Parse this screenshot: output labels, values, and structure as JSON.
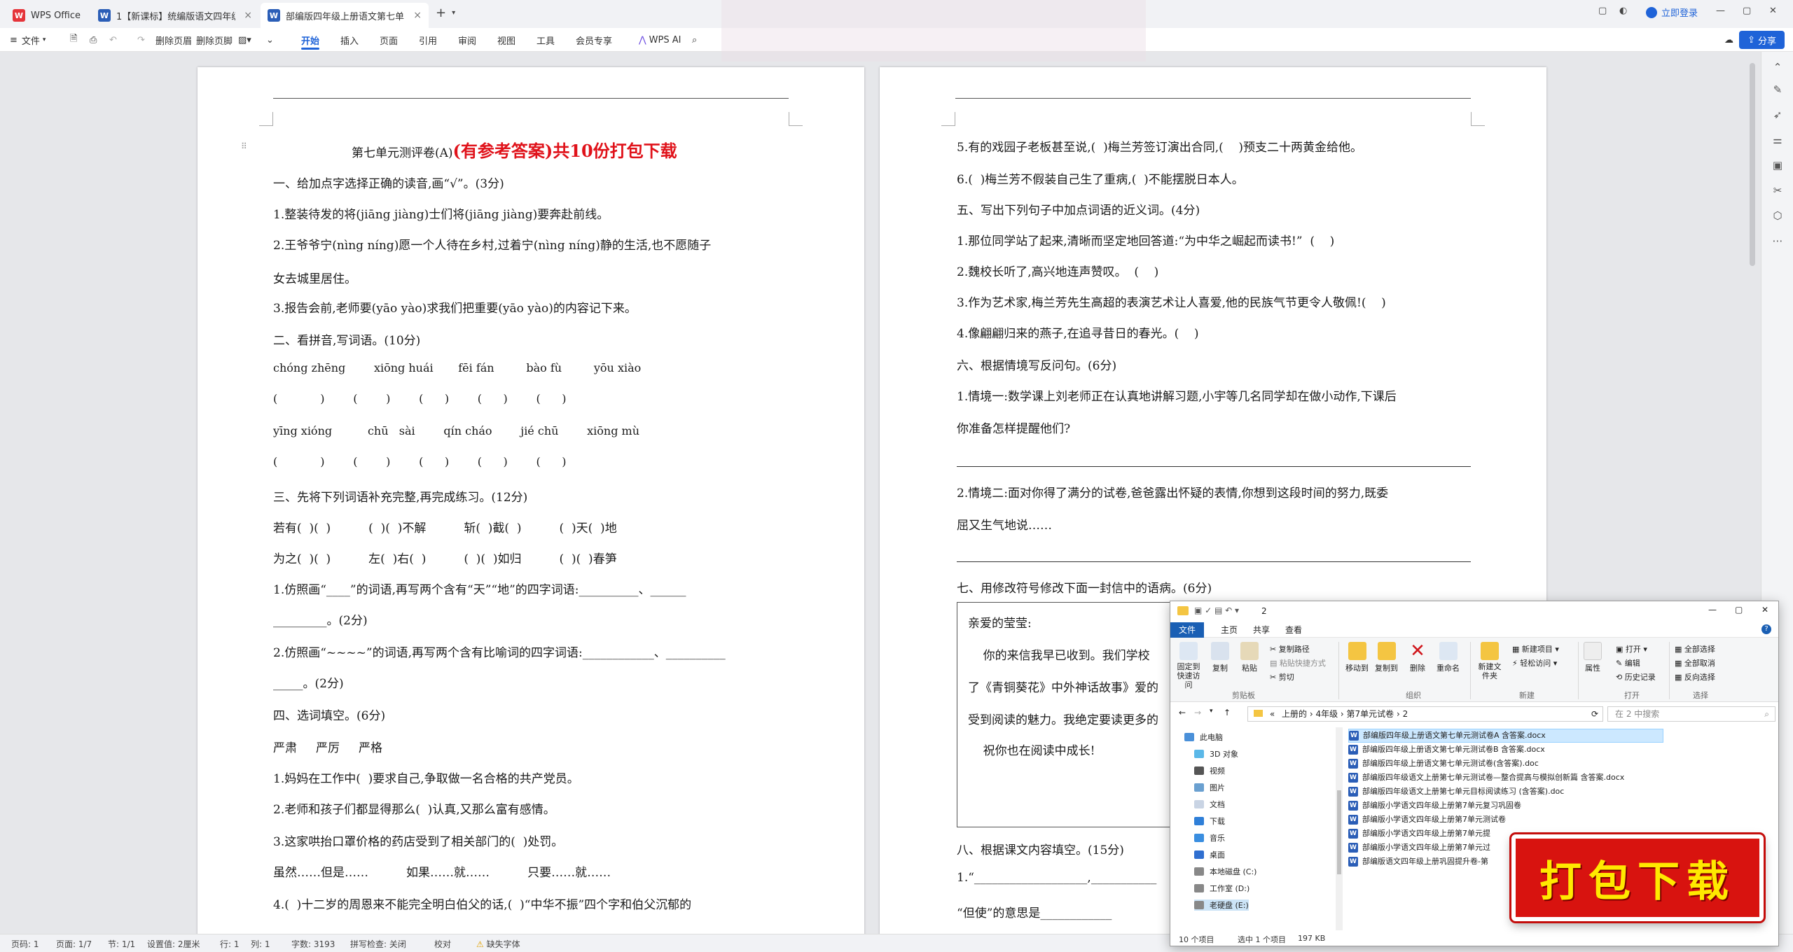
{
  "tabs": [
    {
      "label": "WPS Office",
      "icon": "wps-logo-icon"
    },
    {
      "label": "1【新课标】统编版语文四年级上册第",
      "icon": "word-doc-icon"
    },
    {
      "label": "部编版四年级上册语文第七单",
      "icon": "word-doc-icon"
    }
  ],
  "titlebar": {
    "login": "立即登录",
    "new_tab": "+"
  },
  "ribbon": {
    "file": "文件",
    "delete_header": "删除页眉",
    "delete_footer": "删除页脚",
    "tabs": [
      "开始",
      "插入",
      "页面",
      "引用",
      "审阅",
      "视图",
      "工具",
      "会员专享"
    ],
    "wps_ai": "WPS AI",
    "share": "分享"
  },
  "left_page": {
    "title_plain": "第七单元测评卷(A)",
    "title_red": "(有参考答案)共10份打包下载",
    "lines": [
      "一、给加点字选择正确的读音,画“√”。(3分)",
      "1.整装待发的将(jiāng jiàng)士们将(jiāng jiàng)要奔赴前线。",
      "2.王爷爷宁(nìng níng)愿一个人待在乡村,过着宁(nìng níng)静的生活,也不愿随子",
      "女去城里居住。",
      "3.报告会前,老师要(yāo yào)求我们把重要(yāo yào)的内容记下来。",
      "二、看拼音,写词语。(10分)",
      "chóng zhēng        xiōng huái       fēi fán         bào fù         yōu xiào",
      "(            )        (        )        (      )        (      )        (      )",
      "yīng xióng          chū   sài        qín cháo        jié chū        xiōng mù",
      "(            )        (        )        (      )        (      )        (      )",
      "三、先将下列词语补充完整,再完成练习。(12分)",
      "若有(  )(  )          (  )(  )不解          斩(  )截(  )          (  )天(  )地",
      "为之(  )(  )          左(  )右(  )          (  )(  )如归          (  )(  )春笋",
      "1.仿照画“____”的词语,再写两个含有“天”“地”的四字词语:__________、______",
      "_________。(2分)",
      "2.仿照画“~~~~”的词语,再写两个含有比喻词的四字词语:____________、__________",
      "_____。(2分)",
      "四、选词填空。(6分)",
      "严肃     严厉     严格",
      "1.妈妈在工作中(  )要求自己,争取做一名合格的共产党员。",
      "2.老师和孩子们都显得那么(  )认真,又那么富有感情。",
      "3.这家哄抬口罩价格的药店受到了相关部门的(  )处罚。",
      "虽然……但是……          如果……就……          只要……就……",
      "4.(  )十二岁的周恩来不能完全明白伯父的话,(  )“中华不振”四个字和伯父沉郁的"
    ]
  },
  "right_page": {
    "lines": [
      "5.有的戏园子老板甚至说,(  )梅兰芳签订演出合同,(    )预支二十两黄金给他。",
      "6.(  )梅兰芳不假装自己生了重病,(  )不能摆脱日本人。",
      "五、写出下列句子中加点词语的近义词。(4分)",
      "1.那位同学站了起来,清晰而坚定地回答道:“为中华之崛起而读书!”  (    )",
      "2.魏校长听了,高兴地连声赞叹。  (    )",
      "3.作为艺术家,梅兰芳先生高超的表演艺术让人喜爱,他的民族气节更令人敬佩!(    )",
      "4.像翩翩归来的燕子,在追寻昔日的春光。(    )",
      "六、根据情境写反问句。(6分)",
      "1.情境一:数学课上刘老师正在认真地讲解习题,小宇等几名同学却在做小动作,下课后",
      "你准备怎样提醒他们?",
      "2.情境二:面对你得了满分的试卷,爸爸露出怀疑的表情,你想到这段时间的努力,既委",
      "屈又生气地说……",
      "七、用修改符号修改下面一封信中的语病。(6分)",
      "亲爱的莹莹:",
      "    你的来信我早已收到。我们学校",
      "了《青铜葵花》中外神话故事》爱的",
      "受到阅读的魅力。我绝定要读更多的",
      "    祝你也在阅读中成长!",
      "八、根据课文内容填空。(15分)",
      "1.“___________________,___________",
      "“但使”的意思是____________"
    ]
  },
  "statusbar": {
    "items": [
      "页码: 1",
      "页面: 1/7",
      "节: 1/1",
      "设置值: 2厘米",
      "行: 1",
      "列: 1",
      "字数: 3193",
      "拼写检查: 关闭",
      "校对",
      "缺失字体"
    ]
  },
  "explorer": {
    "title": "2",
    "menus": [
      "文件",
      "主页",
      "共享",
      "查看"
    ],
    "ribbon": {
      "pin": "固定到快速访问",
      "copy": "复制",
      "paste": "粘贴",
      "copy_path": "复制路径",
      "paste_shortcut": "粘贴快捷方式",
      "cut": "剪切",
      "move_to": "移动到",
      "copy_to": "复制到",
      "delete": "删除",
      "rename": "重命名",
      "new_folder": "新建文件夹",
      "new_item": "新建项目",
      "easy_access": "轻松访问",
      "properties": "属性",
      "open": "打开",
      "edit": "编辑",
      "history": "历史记录",
      "select_all": "全部选择",
      "select_none": "全部取消",
      "invert": "反向选择",
      "groups": [
        "剪贴板",
        "组织",
        "新建",
        "打开",
        "选择"
      ]
    },
    "address": [
      "«",
      "上册的",
      "4年级",
      "第7单元试卷",
      "2"
    ],
    "search_placeholder": "在 2 中搜索",
    "nav": [
      "此电脑",
      "3D 对象",
      "视频",
      "图片",
      "文档",
      "下载",
      "音乐",
      "桌面",
      "本地磁盘 (C:)",
      "工作室 (D:)",
      "老硬盘 (E:)"
    ],
    "files": [
      "部编版四年级上册语文第七单元测试卷A    含答案.docx",
      "部编版四年级上册语文第七单元测试卷B    含答案.docx",
      "部编版四年级上册语文第七单元测试卷(含答案).doc",
      "部编版四年级语文上册第七单元测试卷—整合提高与模拟创新篇    含答案.docx",
      "部编版四年级语文上册第七单元目标阅读练习  (含答案).doc",
      "部编版小学语文四年级上册第7单元复习巩固卷",
      "部编版小学语文四年级上册第7单元测试卷",
      "部编版小学语文四年级上册第7单元提",
      "部编版小学语文四年级上册第7单元过",
      "部编版语文四年级上册巩固提升卷-第"
    ],
    "status": {
      "count": "10 个项目",
      "selected": "选中 1 个项目",
      "size": "197 KB"
    }
  },
  "banner": {
    "text": "打包下载"
  },
  "colors": {
    "accent": "#1f63d8",
    "title_red": "#e0121a",
    "banner_red": "#d8130f",
    "banner_text": "#ffe900"
  }
}
